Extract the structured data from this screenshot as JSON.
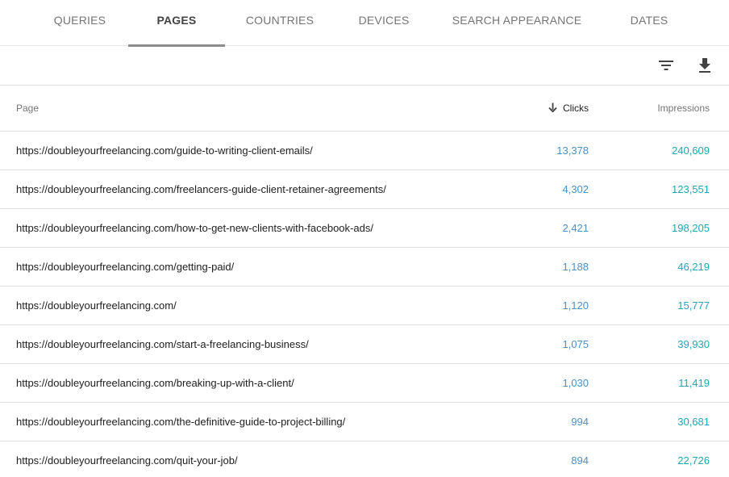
{
  "tabs": [
    {
      "label": "QUERIES",
      "active": false
    },
    {
      "label": "PAGES",
      "active": true
    },
    {
      "label": "COUNTRIES",
      "active": false
    },
    {
      "label": "DEVICES",
      "active": false
    },
    {
      "label": "SEARCH APPEARANCE",
      "active": false
    },
    {
      "label": "DATES",
      "active": false
    }
  ],
  "toolbar": {
    "filter_icon": "filter-icon",
    "download_icon": "download-icon"
  },
  "table": {
    "columns": {
      "page": "Page",
      "clicks": "Clicks",
      "impressions": "Impressions"
    },
    "sort_icon": "arrow-down-icon",
    "rows": [
      {
        "page": "https://doubleyourfreelancing.com/guide-to-writing-client-emails/",
        "clicks": "13,378",
        "impressions": "240,609"
      },
      {
        "page": "https://doubleyourfreelancing.com/freelancers-guide-client-retainer-agreements/",
        "clicks": "4,302",
        "impressions": "123,551"
      },
      {
        "page": "https://doubleyourfreelancing.com/how-to-get-new-clients-with-facebook-ads/",
        "clicks": "2,421",
        "impressions": "198,205"
      },
      {
        "page": "https://doubleyourfreelancing.com/getting-paid/",
        "clicks": "1,188",
        "impressions": "46,219"
      },
      {
        "page": "https://doubleyourfreelancing.com/",
        "clicks": "1,120",
        "impressions": "15,777"
      },
      {
        "page": "https://doubleyourfreelancing.com/start-a-freelancing-business/",
        "clicks": "1,075",
        "impressions": "39,930"
      },
      {
        "page": "https://doubleyourfreelancing.com/breaking-up-with-a-client/",
        "clicks": "1,030",
        "impressions": "11,419"
      },
      {
        "page": "https://doubleyourfreelancing.com/the-definitive-guide-to-project-billing/",
        "clicks": "994",
        "impressions": "30,681"
      },
      {
        "page": "https://doubleyourfreelancing.com/quit-your-job/",
        "clicks": "894",
        "impressions": "22,726"
      }
    ]
  },
  "colors": {
    "clicks": "#4a90c8",
    "impressions": "#22a6b3",
    "tab_indicator": "#8c8c8c"
  }
}
